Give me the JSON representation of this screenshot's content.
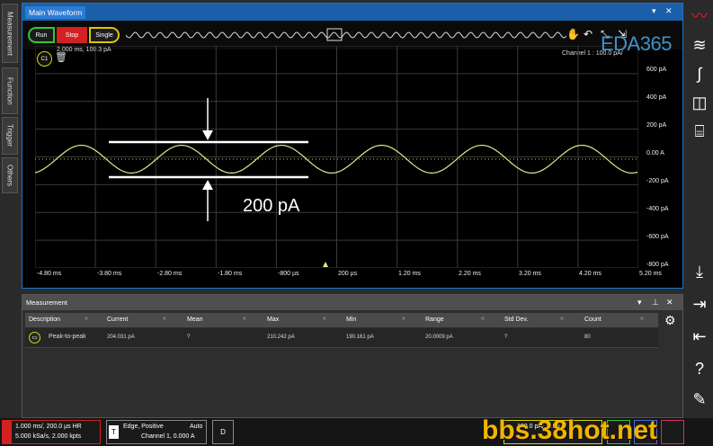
{
  "left_tabs": [
    "Measurement",
    "Function",
    "Trigger",
    "Others"
  ],
  "waveform": {
    "title": "Main Waveform",
    "buttons": {
      "run": "Run",
      "stop": "Stop",
      "single": "Single"
    },
    "channel_badge": "C1",
    "meas_readout": "2.000 ms, 100.3 pA",
    "channel_info": "Channel 1 : 100.0 pA/",
    "y_labels": [
      "600 pA",
      "400 pA",
      "200 pA",
      "0.00 A",
      "-200 pA",
      "-400 pA",
      "-600 pA",
      "-800 pA"
    ],
    "x_labels": [
      "-4.80 ms",
      "-3.80 ms",
      "-2.80 ms",
      "-1.80 ms",
      "-800 µs",
      "200 µs",
      "1.20 ms",
      "2.20 ms",
      "3.20 ms",
      "4.20 ms",
      "5.20 ms"
    ],
    "annotation": "200 pA",
    "trace_color": "#e6e68a",
    "icons": [
      "hand-icon",
      "undo-icon",
      "zoom-icon",
      "cursor-icon",
      "gear-icon"
    ]
  },
  "measurement": {
    "title": "Measurement",
    "columns": [
      "Description",
      "Current",
      "Mean",
      "Max",
      "Min",
      "Range",
      "Std Dev.",
      "Count"
    ],
    "rows": [
      {
        "channel": "C1",
        "description": "Peak-to-peak",
        "current": "204.031 pA",
        "mean": "?",
        "max": "210.242 pA",
        "min": "190.161 pA",
        "range": "20.0009 pA",
        "std": "?",
        "count": "80"
      }
    ]
  },
  "status": {
    "acq_line1": "1.000 ms/, 200.0 µs  HR",
    "acq_line2": "5.000 kSa/s, 2.000 kpts",
    "trig_line1": "Edge, Positive",
    "trig_mode": "Auto",
    "trig_line2": "Channel 1, 0.000 A",
    "trig_icon": "T",
    "d_label": "D",
    "ch1_text": "100.0 pA/, 0.00 A"
  },
  "watermarks": {
    "top": "EDA365",
    "bottom": "bbs.38hot.net"
  }
}
